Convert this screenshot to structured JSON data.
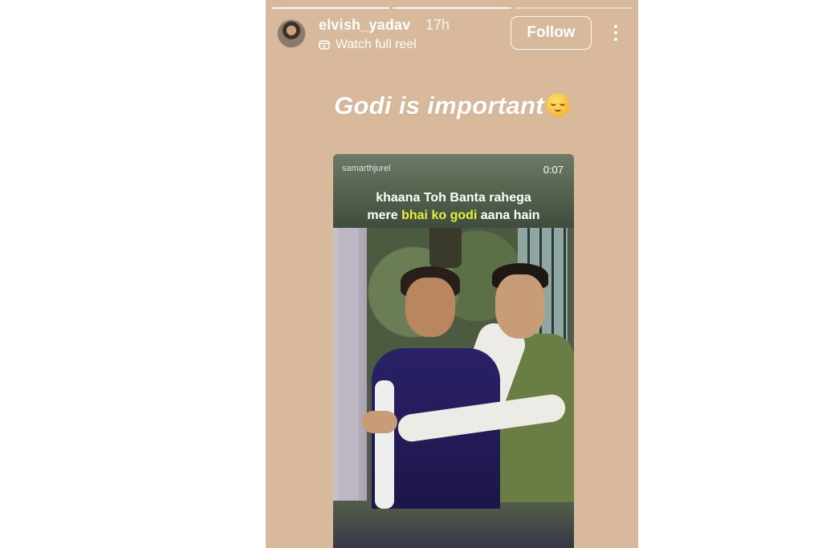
{
  "story": {
    "progress_segments": [
      {
        "state": "done"
      },
      {
        "state": "active"
      },
      {
        "state": "pending"
      }
    ],
    "header": {
      "username": "elvish_yadav",
      "time_ago": "17h",
      "watch_label": "Watch full reel",
      "watch_icon": "reel-icon",
      "follow_label": "Follow",
      "more_icon": "more-vertical-icon"
    },
    "caption": {
      "text": "Godi is important",
      "emoji": "relieved-face-emoji"
    },
    "reel": {
      "author": "samarthjurel",
      "duration": "0:07",
      "subtitle_line1": "khaana Toh Banta rahega",
      "subtitle_line2_pre": "mere ",
      "subtitle_line2_highlight": "bhai ko godi",
      "subtitle_line2_post": " aana hain",
      "highlight_color": "#e7f03a"
    },
    "background_color": "#d8b99c"
  }
}
